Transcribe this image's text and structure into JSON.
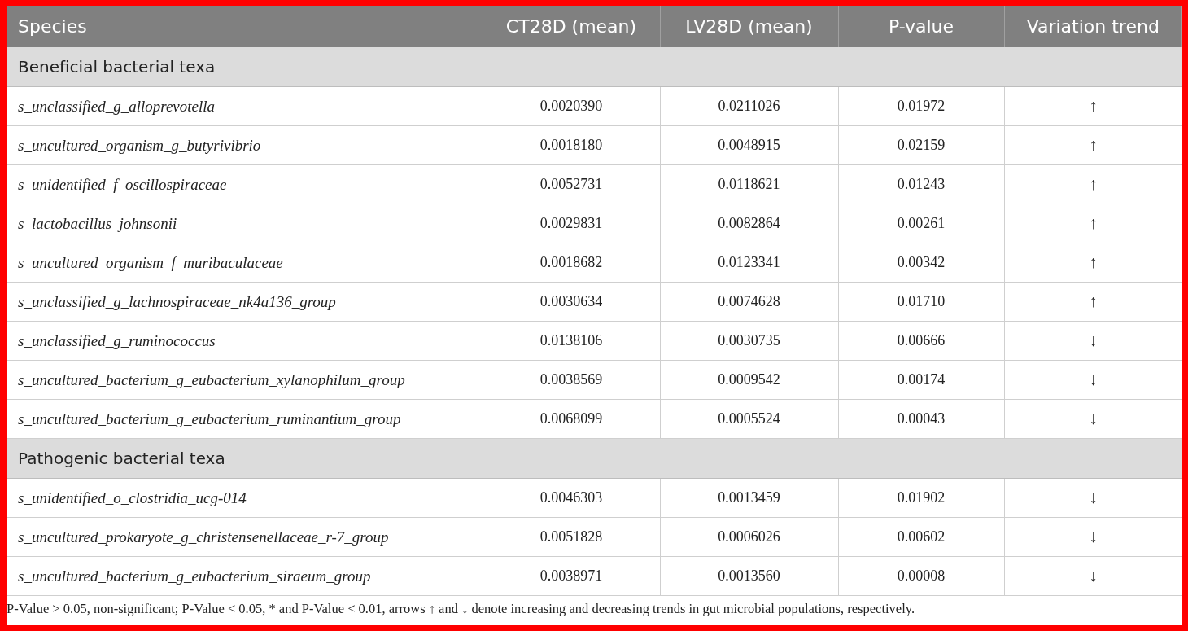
{
  "table": {
    "columns": [
      "Species",
      "CT28D (mean)",
      "LV28D (mean)",
      "P-value",
      "Variation trend"
    ],
    "sections": [
      {
        "title": "Beneficial bacterial texa",
        "rows": [
          {
            "species": "s_unclassified_g_alloprevotella",
            "ct28d": "0.0020390",
            "lv28d": "0.0211026",
            "p_value": "0.01972",
            "trend": "↑"
          },
          {
            "species": "s_uncultured_organism_g_butyrivibrio",
            "ct28d": "0.0018180",
            "lv28d": "0.0048915",
            "p_value": "0.02159",
            "trend": "↑"
          },
          {
            "species": "s_unidentified_f_oscillospiraceae",
            "ct28d": "0.0052731",
            "lv28d": "0.0118621",
            "p_value": "0.01243",
            "trend": "↑"
          },
          {
            "species": "s_lactobacillus_johnsonii",
            "ct28d": "0.0029831",
            "lv28d": "0.0082864",
            "p_value": "0.00261",
            "trend": "↑"
          },
          {
            "species": "s_uncultured_organism_f_muribaculaceae",
            "ct28d": "0.0018682",
            "lv28d": "0.0123341",
            "p_value": "0.00342",
            "trend": "↑"
          },
          {
            "species": "s_unclassified_g_lachnospiraceae_nk4a136_group",
            "ct28d": "0.0030634",
            "lv28d": "0.0074628",
            "p_value": "0.01710",
            "trend": "↑"
          },
          {
            "species": "s_unclassified_g_ruminococcus",
            "ct28d": "0.0138106",
            "lv28d": "0.0030735",
            "p_value": "0.00666",
            "trend": "↓"
          },
          {
            "species": "s_uncultured_bacterium_g_eubacterium_xylanophilum_group",
            "ct28d": "0.0038569",
            "lv28d": "0.0009542",
            "p_value": "0.00174",
            "trend": "↓"
          },
          {
            "species": "s_uncultured_bacterium_g_eubacterium_ruminantium_group",
            "ct28d": "0.0068099",
            "lv28d": "0.0005524",
            "p_value": "0.00043",
            "trend": "↓"
          }
        ]
      },
      {
        "title": "Pathogenic bacterial texa",
        "rows": [
          {
            "species": "s_unidentified_o_clostridia_ucg-014",
            "ct28d": "0.0046303",
            "lv28d": "0.0013459",
            "p_value": "0.01902",
            "trend": "↓"
          },
          {
            "species": "s_uncultured_prokaryote_g_christensenellaceae_r-7_group",
            "ct28d": "0.0051828",
            "lv28d": "0.0006026",
            "p_value": "0.00602",
            "trend": "↓"
          },
          {
            "species": "s_uncultured_bacterium_g_eubacterium_siraeum_group",
            "ct28d": "0.0038971",
            "lv28d": "0.0013560",
            "p_value": "0.00008",
            "trend": "↓"
          }
        ]
      }
    ]
  },
  "footnote": "P-Value > 0.05, non-significant; P-Value < 0.05, * and P-Value < 0.01, arrows ↑ and ↓ denote increasing and decreasing trends in gut microbial populations, respectively."
}
